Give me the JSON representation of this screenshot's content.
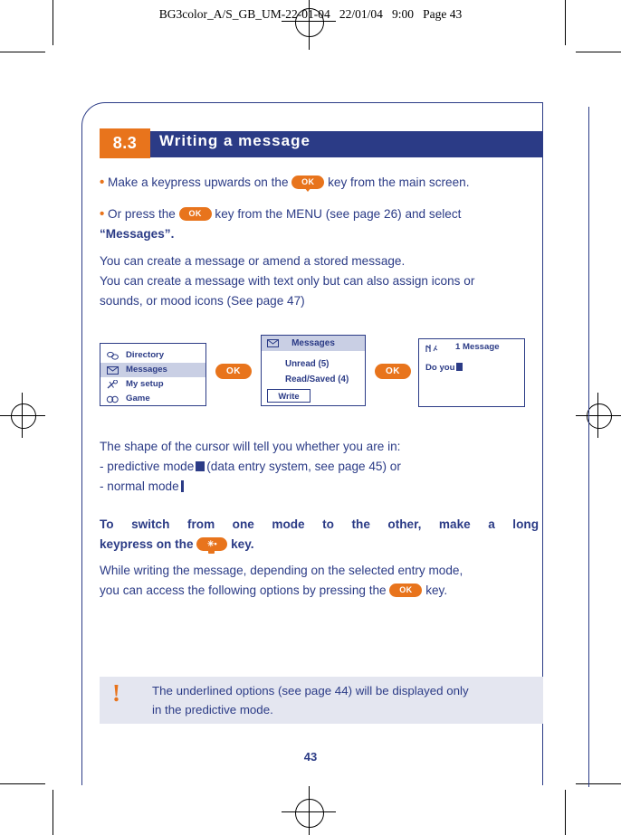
{
  "print_header": "BG3color_A/S_GB_UM-22-01-04   22/01/04   9:00   Page 43",
  "section": {
    "number": "8.3",
    "title": "Writing a message"
  },
  "bullets": [
    {
      "pre": "Make a keypress upwards on the",
      "key": "OK",
      "post": "key from the main screen."
    },
    {
      "pre": "Or press the",
      "key": "OK",
      "post": "key from the MENU (see page 26) and select",
      "post2": "“Messages”."
    }
  ],
  "paragraphs": {
    "p1_line1": "You can create a message or amend a stored message.",
    "p1_line2": "You can create a message with text only but can also assign icons or",
    "p1_line3": "sounds, or mood icons (See page 47)",
    "p2_line1": "The shape of the cursor will tell you whether you are in:",
    "p2_line2_pre": "- predictive mode",
    "p2_line2_post": "(data entry system, see page 45) or",
    "p2_line3": "- normal mode",
    "p3_line1": "To switch from one mode to the other, make a long",
    "p3_line2_pre": "keypress on the",
    "p3_line2_post": "key.",
    "p4_line1": "While writing the message, depending on the selected entry mode,",
    "p4_line2_pre": "you can access the following options by pressing the",
    "p4_line2_post": "key."
  },
  "screens": {
    "menu": {
      "items": [
        {
          "label": "Directory",
          "icon": "directory-icon",
          "selected": false
        },
        {
          "label": "Messages",
          "icon": "envelope-icon",
          "selected": true
        },
        {
          "label": "My setup",
          "icon": "tools-icon",
          "selected": false
        },
        {
          "label": "Game",
          "icon": "game-icon",
          "selected": false
        }
      ]
    },
    "messages": {
      "title": "Messages",
      "title_icon": "envelope-icon",
      "items": [
        "Unread (5)",
        "Read/Saved (4)"
      ],
      "softkey": "Write"
    },
    "compose": {
      "status_icon": "signal-icon",
      "title": "1 Message",
      "text": "Do you"
    },
    "ok_button_1": "OK",
    "ok_button_2": "OK"
  },
  "keys": {
    "ok_label": "OK",
    "star_label": "✳•"
  },
  "note": {
    "mark": "!",
    "line1": "The underlined options (see page 44) will be displayed only",
    "line2": "in the predictive mode."
  },
  "page_number": "43",
  "colors": {
    "brand_blue": "#2b3b86",
    "accent_orange": "#e8741c",
    "screen_highlight": "#c9cfe4",
    "note_bg": "#e4e6f0"
  }
}
